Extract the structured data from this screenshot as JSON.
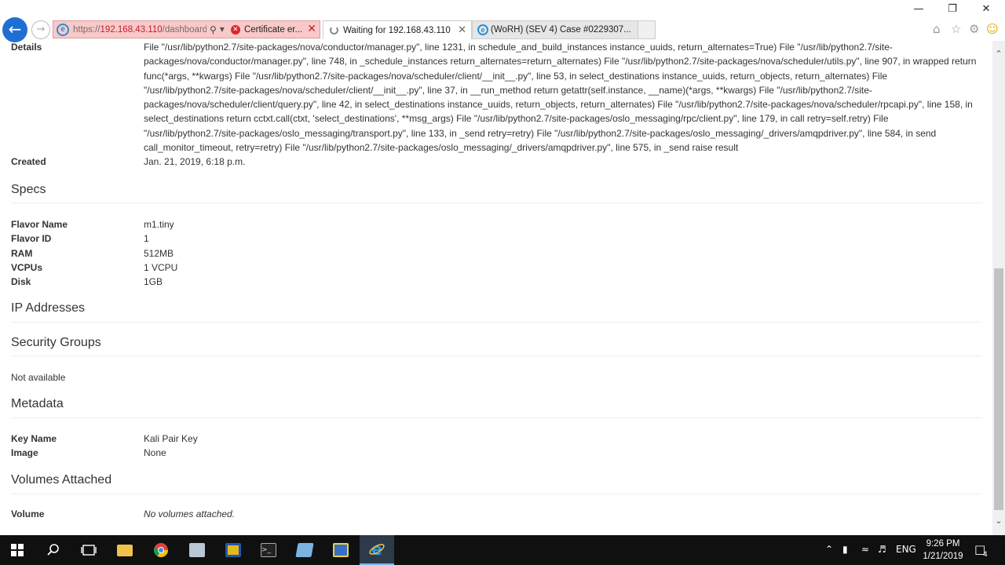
{
  "browser": {
    "url_prefix": "https://",
    "url_host": "192.168.43.110",
    "url_path": "/dashboard/p",
    "cert_error": "Certificate er...",
    "tabs": [
      {
        "label": "Waiting for 192.168.43.110"
      },
      {
        "label": "(WoRH) (SEV 4) Case #0229307..."
      }
    ],
    "icons": [
      "back-arrow-icon",
      "forward-arrow-icon",
      "search-icon",
      "dropdown-icon",
      "certificate-error-icon",
      "close-icon",
      "home-icon",
      "favorites-star-icon",
      "settings-gear-icon",
      "feedback-smiley-icon"
    ]
  },
  "instance": {
    "details_label": "Details",
    "details_text": "File \"/usr/lib/python2.7/site-packages/nova/conductor/manager.py\", line 1231, in schedule_and_build_instances instance_uuids, return_alternates=True) File \"/usr/lib/python2.7/site-packages/nova/conductor/manager.py\", line 748, in _schedule_instances return_alternates=return_alternates) File \"/usr/lib/python2.7/site-packages/nova/scheduler/utils.py\", line 907, in wrapped return func(*args, **kwargs) File \"/usr/lib/python2.7/site-packages/nova/scheduler/client/__init__.py\", line 53, in select_destinations instance_uuids, return_objects, return_alternates) File \"/usr/lib/python2.7/site-packages/nova/scheduler/client/__init__.py\", line 37, in __run_method return getattr(self.instance, __name)(*args, **kwargs) File \"/usr/lib/python2.7/site-packages/nova/scheduler/client/query.py\", line 42, in select_destinations instance_uuids, return_objects, return_alternates) File \"/usr/lib/python2.7/site-packages/nova/scheduler/rpcapi.py\", line 158, in select_destinations return cctxt.call(ctxt, 'select_destinations', **msg_args) File \"/usr/lib/python2.7/site-packages/oslo_messaging/rpc/client.py\", line 179, in call retry=self.retry) File \"/usr/lib/python2.7/site-packages/oslo_messaging/transport.py\", line 133, in _send retry=retry) File \"/usr/lib/python2.7/site-packages/oslo_messaging/_drivers/amqpdriver.py\", line 584, in send call_monitor_timeout, retry=retry) File \"/usr/lib/python2.7/site-packages/oslo_messaging/_drivers/amqpdriver.py\", line 575, in _send raise result",
    "created_label": "Created",
    "created_value": "Jan. 21, 2019, 6:18 p.m."
  },
  "specs": {
    "heading": "Specs",
    "rows": [
      {
        "label": "Flavor Name",
        "value": "m1.tiny"
      },
      {
        "label": "Flavor ID",
        "value": "1"
      },
      {
        "label": "RAM",
        "value": "512MB"
      },
      {
        "label": "VCPUs",
        "value": "1 VCPU"
      },
      {
        "label": "Disk",
        "value": "1GB"
      }
    ]
  },
  "ip_addresses": {
    "heading": "IP Addresses"
  },
  "security_groups": {
    "heading": "Security Groups",
    "value": "Not available"
  },
  "metadata": {
    "heading": "Metadata",
    "rows": [
      {
        "label": "Key Name",
        "value": "Kali Pair Key"
      },
      {
        "label": "Image",
        "value": "None"
      }
    ]
  },
  "volumes": {
    "heading": "Volumes Attached",
    "label": "Volume",
    "value": "No volumes attached."
  },
  "taskbar": {
    "apps": [
      "start-icon",
      "search-icon",
      "task-view-icon",
      "file-explorer-icon",
      "chrome-icon",
      "vm-app-icon",
      "virtualbox-icon",
      "terminal-icon",
      "notepad-icon",
      "network-app-icon",
      "internet-explorer-icon"
    ],
    "language": "ENG",
    "time": "9:26 PM",
    "date": "1/21/2019",
    "notification_count": "4"
  },
  "colors": {
    "address_bar_error": "#f8c9c9",
    "back_button": "#1f6fd2",
    "taskbar": "#101010",
    "text": "#333333"
  }
}
